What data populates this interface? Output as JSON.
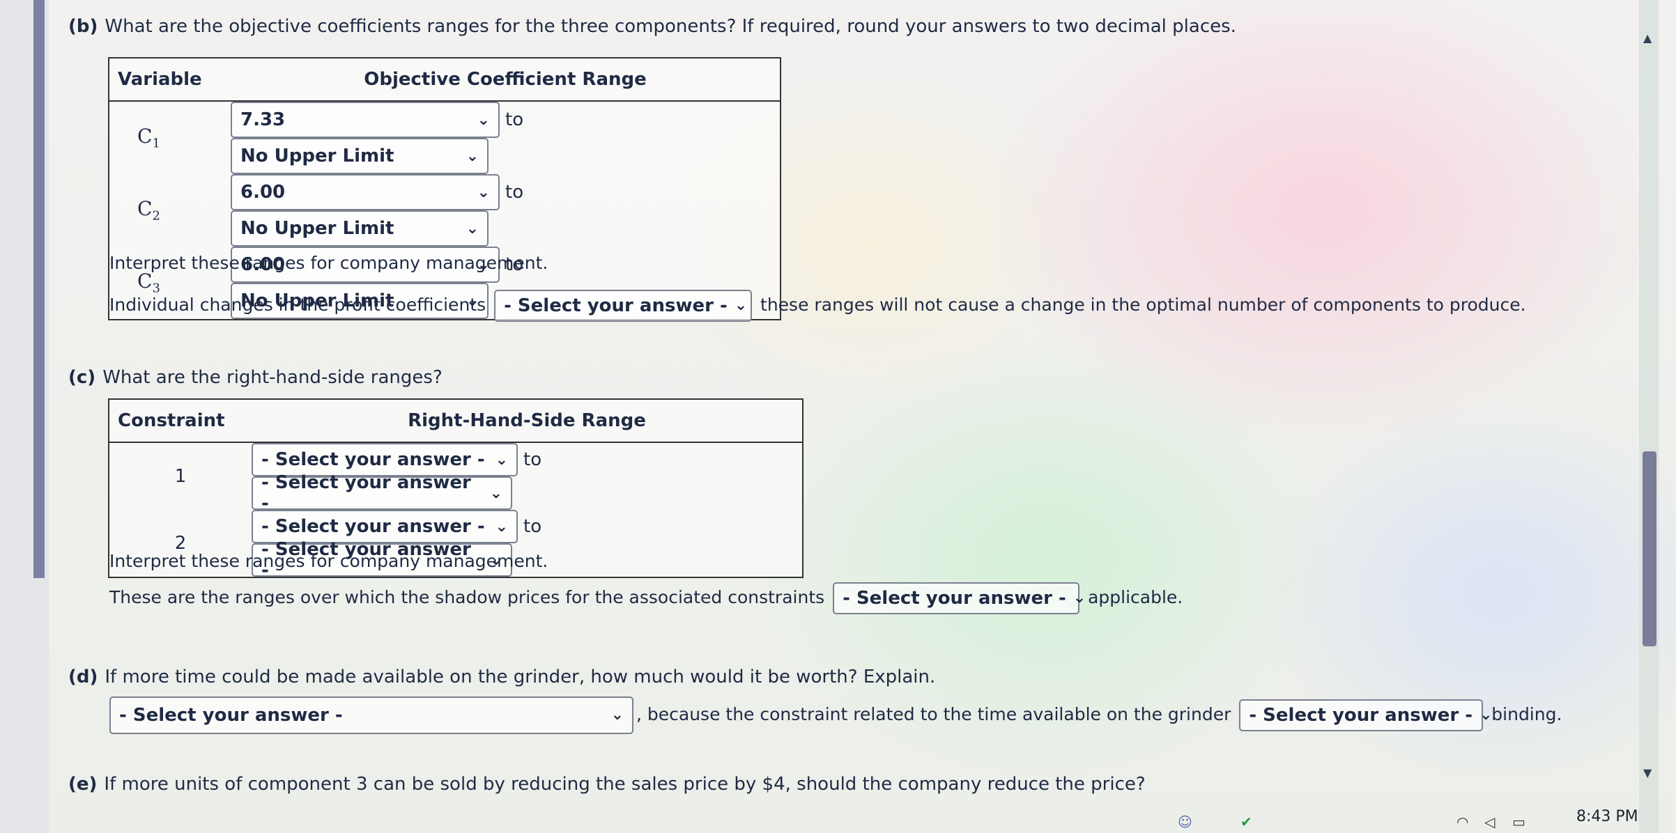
{
  "part_b": {
    "label": "(b)",
    "question": "What are the objective coefficients ranges for the three components? If required, round your answers to two decimal places.",
    "headers": [
      "Variable",
      "Objective Coefficient Range"
    ],
    "rows": [
      {
        "var": "C",
        "sub": "1",
        "low": "7.33",
        "to": "to",
        "high": "No Upper Limit"
      },
      {
        "var": "C",
        "sub": "2",
        "low": "6.00",
        "to": "to",
        "high": "No Upper Limit"
      },
      {
        "var": "C",
        "sub": "3",
        "low": "6.00",
        "to": "to",
        "high": "No Upper Limit"
      }
    ],
    "interpret": "Interpret these ranges for company management.",
    "sentence_before": "Individual changes in the profit coefficients",
    "select": "- Select your answer -",
    "sentence_after": "these ranges will not cause a change in the optimal number of components to produce."
  },
  "part_c": {
    "label": "(c)",
    "question": "What are the right-hand-side ranges?",
    "headers": [
      "Constraint",
      "Right-Hand-Side Range"
    ],
    "rows": [
      {
        "num": "1",
        "low": "- Select your answer -",
        "to": "to",
        "high": "- Select your answer -"
      },
      {
        "num": "2",
        "low": "- Select your answer -",
        "to": "to",
        "high": "- Select your answer -"
      }
    ],
    "interpret": "Interpret these ranges for company management.",
    "sentence_before": "These are the ranges over which the shadow prices for the associated constraints",
    "select": "- Select your answer -",
    "sentence_after": "applicable."
  },
  "part_d": {
    "label": "(d)",
    "question": "If more time could be made available on the grinder, how much would it be worth? Explain.",
    "select1": "- Select your answer -",
    "sentence_mid": ", because the constraint related to the time available on the grinder",
    "select2": "- Select your answer -",
    "sentence_after": "binding."
  },
  "part_e": {
    "label": "(e)",
    "question": "If more units of component 3 can be sold by reducing the sales price by $4, should the company reduce the price?"
  },
  "taskbar": {
    "clock": "8:43 PM"
  }
}
